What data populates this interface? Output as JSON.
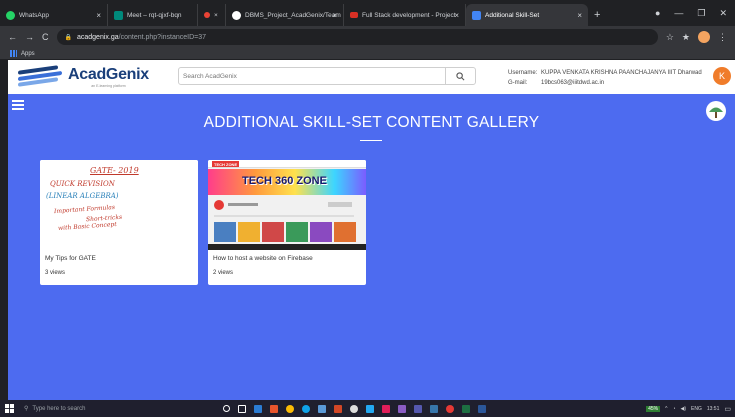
{
  "browser": {
    "tabs": [
      {
        "label": "WhatsApp",
        "favicon_color": "#25d366",
        "close": "×"
      },
      {
        "label": "Meet – rqt-qjxf-bqn",
        "favicon_color": "#00897b",
        "close": ""
      },
      {
        "label": "×",
        "favicon_color": "#ea4335",
        "close": ""
      },
      {
        "label": "DBMS_Project_AcadGenix/Team",
        "favicon_color": "#ffffff",
        "close": "×"
      },
      {
        "label": "Full Stack development - Project",
        "favicon_color": "#d93025",
        "close": "×"
      },
      {
        "label": "Additional Skill-Set",
        "favicon_color": "#4285f4",
        "close": "×"
      }
    ],
    "new_tab": "+",
    "url_host": "acadgenix.ga",
    "url_path": "/content.php?instanceID=37",
    "bookmarks_apps": "Apps"
  },
  "header": {
    "logo_name": "AcadGenix",
    "logo_tagline": "an E-learning platform",
    "search_placeholder": "Search AcadGenix",
    "username_label": "Username:",
    "username_value": "KUPPA VENKATA KRISHNA PAANCHAJANYA IIIT Dharwad",
    "gmail_label": "G-mail:",
    "gmail_value": "19bcs063@iiitdwd.ac.in",
    "avatar_letter": "K"
  },
  "gallery": {
    "title": "ADDITIONAL SKILL-SET CONTENT GALLERY",
    "cards": [
      {
        "title": "My Tips for GATE",
        "views": "3 views",
        "note_lines": [
          "GATE- 2019",
          "QUICK REVISION",
          "(LINEAR ALGEBRA)",
          "Important Formulas",
          "Short-tricks",
          "with Basic Concept"
        ]
      },
      {
        "title": "How to host a website on Firebase",
        "views": "2 views",
        "banner_text": "TECH 360 ZONE",
        "channel_badge": "TECH ZONE"
      }
    ]
  },
  "taskbar": {
    "search_placeholder": "Type here to search",
    "battery": "45%",
    "lang": "ENG",
    "time": "13:51"
  }
}
